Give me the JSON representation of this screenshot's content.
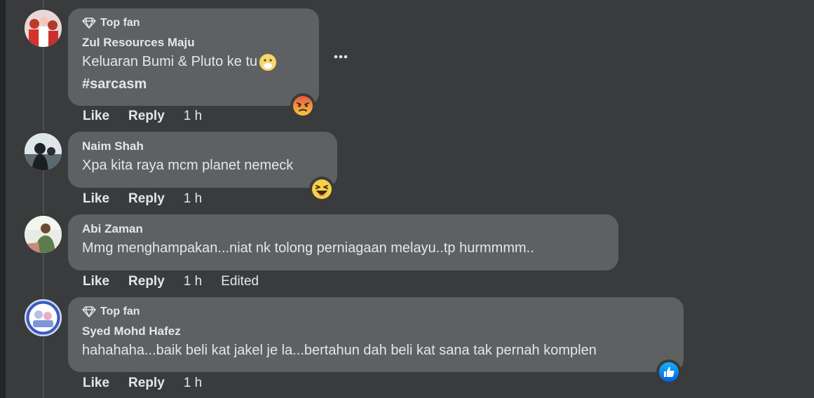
{
  "comments": [
    {
      "badge": "Top fan",
      "author": "Zul Resources Maju",
      "lines": [
        "Keluaran Bumi & Pluto ke tu",
        "#sarcasm"
      ],
      "like": "Like",
      "reply": "Reply",
      "time": "1 h",
      "reaction_icon": "angry-face-icon"
    },
    {
      "author": "Naim Shah",
      "lines": [
        "Xpa kita raya mcm planet nemeck"
      ],
      "like": "Like",
      "reply": "Reply",
      "time": "1 h",
      "reaction_icon": "laughing-face-icon"
    },
    {
      "author": "Abi Zaman",
      "lines": [
        "Mmg menghampakan...niat nk tolong perniagaan melayu..tp hurmmmm.."
      ],
      "like": "Like",
      "reply": "Reply",
      "time": "1 h",
      "edited": "Edited"
    },
    {
      "badge": "Top fan",
      "author": "Syed Mohd Hafez",
      "lines": [
        "hahahaha...baik beli kat jakel je la...bertahun dah beli kat sana tak pernah komplen"
      ],
      "like": "Like",
      "reply": "Reply",
      "time": "1 h",
      "reaction_icon": "thumbs-up-icon"
    }
  ],
  "colors": {
    "background": "#3a3b3c",
    "bubble": "#5f6061",
    "text": "#e4e6eb"
  }
}
